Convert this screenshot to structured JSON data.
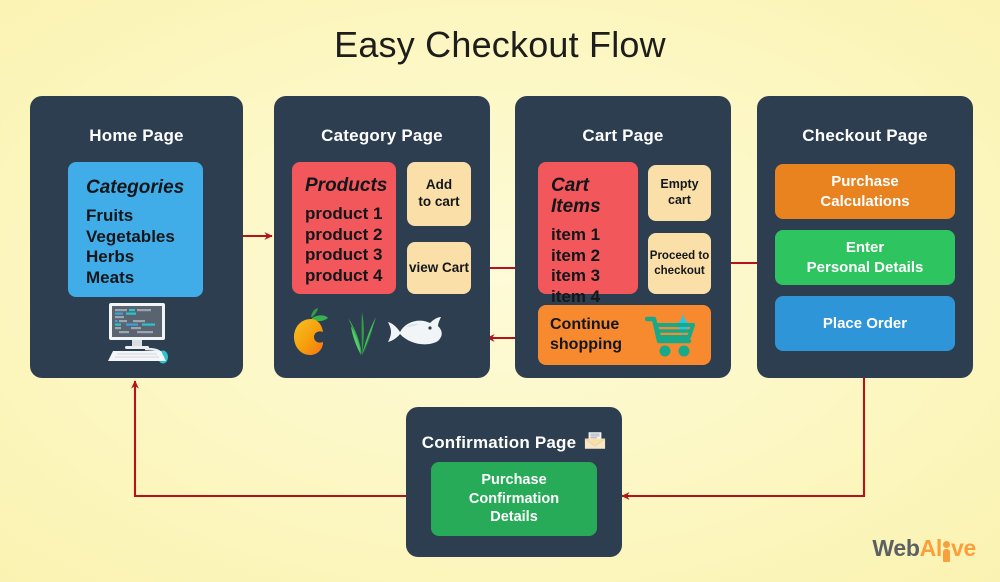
{
  "title": "Easy Checkout Flow",
  "theme": {
    "background": "#fcf6bf",
    "panel": "#2d3e50",
    "arrow": "#b5121b",
    "blue": "#40ade9",
    "red": "#f2575c",
    "tan": "#fadfa8",
    "orange": "#f7892e",
    "green": "#2ec45f",
    "accent_blue": "#2e95d8",
    "teal": "#18a88a"
  },
  "panels": {
    "home": {
      "title": "Home Page",
      "categories_card": {
        "heading": "Categories",
        "items": [
          "Fruits",
          "Vegetables",
          "Herbs",
          "Meats"
        ]
      },
      "icon": "computer-monitor-icon"
    },
    "category": {
      "title": "Category Page",
      "products_card": {
        "heading": "Products",
        "items": [
          "product 1",
          "product 2",
          "product 3",
          "product 4"
        ]
      },
      "add_to_cart_label": "Add\nto cart",
      "add_to_cart_line1": "Add",
      "add_to_cart_line2": "to cart",
      "view_cart_label": "view Cart",
      "icons": [
        "mango-icon",
        "herbs-icon",
        "fish-icon"
      ]
    },
    "cart": {
      "title": "Cart Page",
      "cart_items_card": {
        "heading": "Cart Items",
        "items": [
          "item 1",
          "item 2",
          "item 3",
          "item 4"
        ]
      },
      "empty_cart_label": "Empty cart",
      "proceed_line1": "Proceed to",
      "proceed_line2": "checkout",
      "continue_line1": "Continue",
      "continue_line2": "shopping",
      "icon": "shopping-cart-icon"
    },
    "checkout": {
      "title": "Checkout Page",
      "purchase_calculations_line1": "Purchase",
      "purchase_calculations_line2": "Calculations",
      "enter_details_line1": "Enter",
      "enter_details_line2": "Personal Details",
      "place_order_label": "Place Order"
    },
    "confirmation": {
      "title": "Confirmation Page",
      "icon": "envelope-icon",
      "details_line1": "Purchase",
      "details_line2": "Confirmation",
      "details_line3": "Details"
    }
  },
  "logo": {
    "part1": "Web",
    "part2": "Al",
    "part3": "ve"
  }
}
